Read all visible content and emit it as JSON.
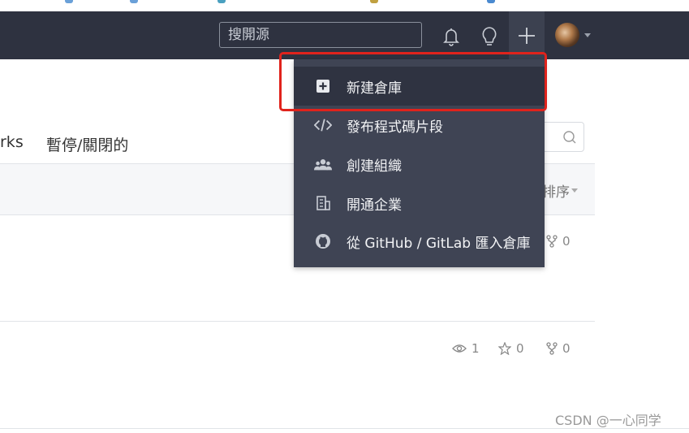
{
  "navbar": {
    "search_placeholder": "搜開源"
  },
  "icons": {
    "bell": "bell-icon",
    "lightbulb": "lightbulb-icon",
    "plus": "plus-icon",
    "avatar": "user-avatar"
  },
  "tabs": {
    "forks_partial": "rks",
    "paused_closed": "暫停/關閉的"
  },
  "list": {
    "sort_label": "排序",
    "row1": {
      "fork_count": "0"
    },
    "row2": {
      "watch_count": "1",
      "star_count": "0",
      "fork_count": "0"
    }
  },
  "dropdown": {
    "items": [
      {
        "label": "新建倉庫",
        "icon": "plus-square-icon"
      },
      {
        "label": "發布程式碼片段",
        "icon": "code-icon"
      },
      {
        "label": "創建組織",
        "icon": "group-icon"
      },
      {
        "label": "開通企業",
        "icon": "building-icon"
      },
      {
        "label": "從 GitHub / GitLab 匯入倉庫",
        "icon": "github-icon"
      }
    ]
  },
  "colors": {
    "navbar_bg": "#2e3240",
    "dropdown_bg": "#3f4454",
    "active_item_bg": "#2f3341",
    "highlight": "#e0231c"
  },
  "watermark": "CSDN @一心同学"
}
